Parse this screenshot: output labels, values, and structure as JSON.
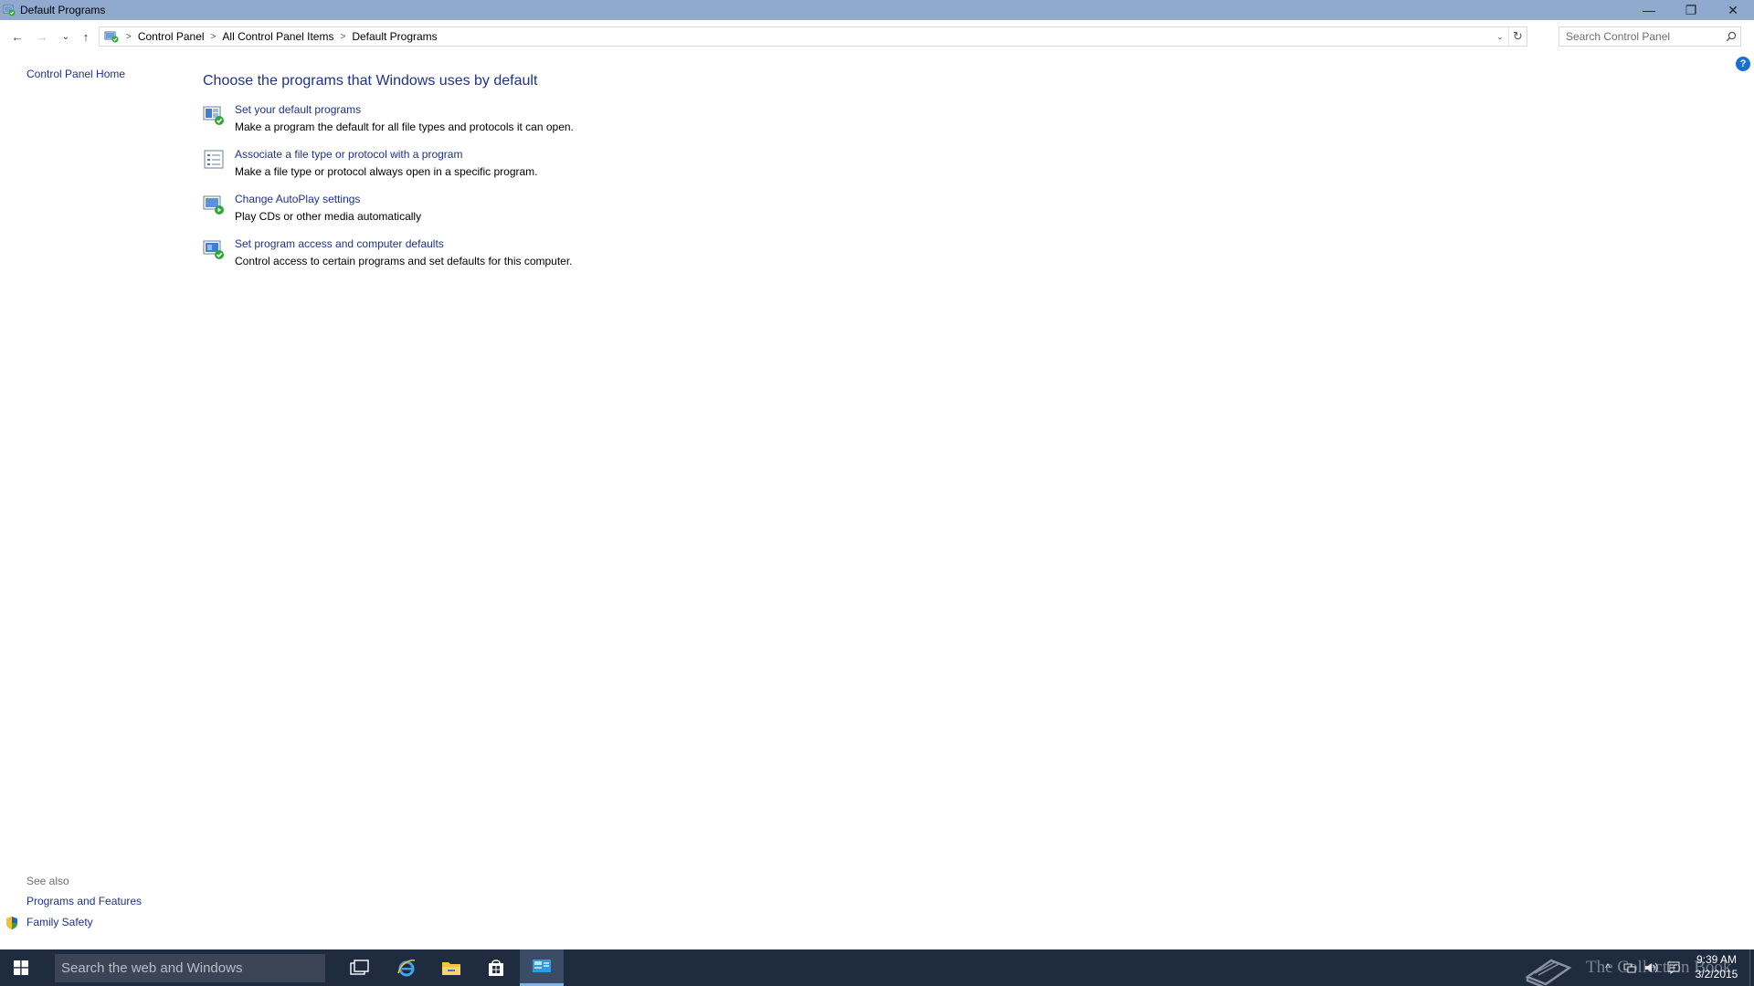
{
  "window": {
    "title": "Default Programs",
    "controls": {
      "minimize": "—",
      "restore": "❐",
      "close": "✕"
    }
  },
  "nav": {
    "back": "←",
    "forward": "→",
    "recent": "⌄",
    "up": "↑",
    "breadcrumb": [
      "Control Panel",
      "All Control Panel Items",
      "Default Programs"
    ],
    "separator": ">",
    "dropdown": "⌄",
    "refresh": "↻"
  },
  "search": {
    "placeholder": "Search Control Panel"
  },
  "sidebar": {
    "home_label": "Control Panel Home"
  },
  "help": {
    "label": "?"
  },
  "main": {
    "title": "Choose the programs that Windows uses by default",
    "tasks": [
      {
        "link": "Set your default programs",
        "desc": "Make a program the default for all file types and protocols it can open.",
        "icon": "default-programs-icon"
      },
      {
        "link": "Associate a file type or protocol with a program",
        "desc": "Make a file type or protocol always open in a specific program.",
        "icon": "file-association-icon"
      },
      {
        "link": "Change AutoPlay settings",
        "desc": "Play CDs or other media automatically",
        "icon": "autoplay-icon"
      },
      {
        "link": "Set program access and computer defaults",
        "desc": "Control access to certain programs and set defaults for this computer.",
        "icon": "program-access-icon"
      }
    ]
  },
  "see_also": {
    "label": "See also",
    "links": [
      "Programs and Features",
      "Family Safety"
    ]
  },
  "taskbar": {
    "search_placeholder": "Search the web and Windows",
    "watermark": "The Collection Book",
    "clock_time": "9:39 AM",
    "clock_date": "3/2/2015",
    "tray_chevron": "^"
  },
  "colors": {
    "titlebar": "#8fa9cf",
    "link": "#1e3287",
    "taskbar": "#1f2b3e"
  }
}
